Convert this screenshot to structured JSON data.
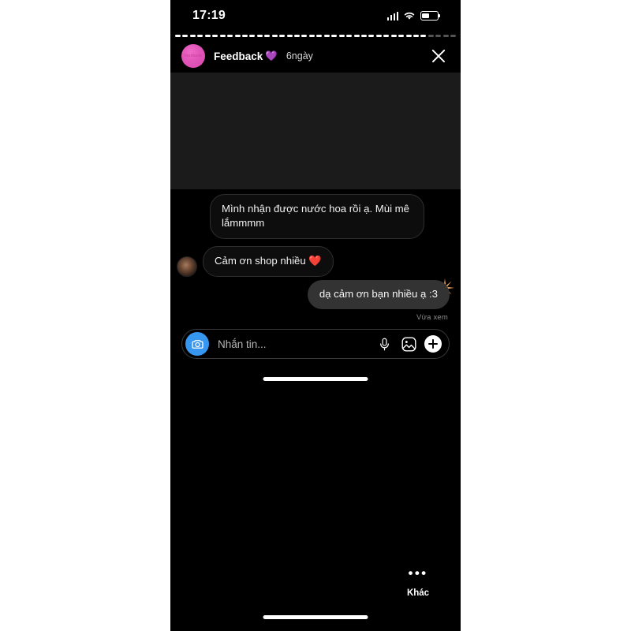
{
  "statusbar": {
    "time": "17:19",
    "signal_icon": "signal-bars-icon",
    "wifi_icon": "wifi-icon",
    "battery_icon": "battery-icon",
    "battery_level_pct": 42
  },
  "story": {
    "progress_segments_total": 38,
    "progress_segments_filled": 34,
    "username": "Feedback",
    "username_emoji": "💜",
    "timestamp": "6ngày",
    "close_icon": "close-icon",
    "avatar_icon": "avatar",
    "avatar_caption": "feedback",
    "media_color": "#1b1b1b"
  },
  "chat": {
    "messages": [
      {
        "id": "msg-1",
        "direction": "incoming",
        "text": "Mình nhận được nước hoa rồi ạ. Mùi mê lắmmmm",
        "has_avatar": false
      },
      {
        "id": "msg-2",
        "direction": "incoming",
        "text": "Cảm ơn shop nhiều ❤️",
        "has_avatar": true
      },
      {
        "id": "msg-3",
        "direction": "outgoing",
        "text": "dạ cảm ơn bạn nhiều ạ :3",
        "has_avatar": false
      }
    ],
    "reaction_icon": "sparkle-icon",
    "status_text": "Vừa xem"
  },
  "composer": {
    "camera_icon": "camera-icon",
    "placeholder": "Nhắn tin...",
    "mic_icon": "microphone-icon",
    "gallery_icon": "image-icon",
    "add_icon": "plus-icon",
    "accent_color": "#3797f0"
  },
  "bottom": {
    "more_dots": "•••",
    "more_label": "Khác"
  },
  "colors": {
    "page_background": "#ffffff",
    "screen_background": "#000000",
    "story_media": "#1b1b1b",
    "bubble_in": "#0d0d0d",
    "bubble_in_border": "#2e2e2e",
    "bubble_out": "#333333",
    "avatar_pink": "#e055b8",
    "sparkle_orange": "#e8a060"
  }
}
